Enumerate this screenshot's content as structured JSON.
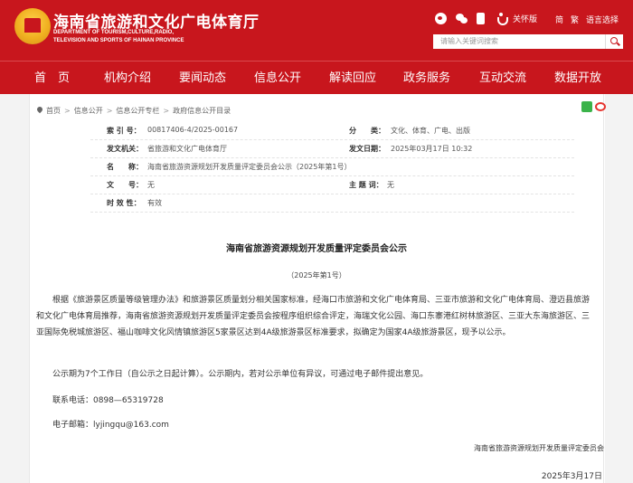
{
  "header": {
    "title": "海南省旅游和文化广电体育厅",
    "subtitle_line1": "DEPARTMENT OF TOURISM,CULTURE,RADIO,",
    "subtitle_line2": "TELEVISION AND SPORTS OF HAINAN PROVINCE",
    "care_mode": "关怀版",
    "simplified": "简",
    "traditional": "繁",
    "language": "语言选择",
    "search_placeholder": "请输入关键词搜索"
  },
  "nav": {
    "items": [
      "首　页",
      "机构介绍",
      "要闻动态",
      "信息公开",
      "解读回应",
      "政务服务",
      "互动交流",
      "数据开放"
    ]
  },
  "breadcrumb": {
    "items": [
      "首页",
      "信息公开",
      "信息公开专栏",
      "政府信息公开目录"
    ]
  },
  "meta": {
    "index_label": "索 引 号：",
    "index_value": "00817406-4/2025-00167",
    "category_label": "分　　类：",
    "category_value": "文化、体育、广电、出版",
    "issuer_label": "发文机关：",
    "issuer_value": "省旅游和文化广电体育厅",
    "date_label": "发文日期：",
    "date_value": "2025年03月17日 10:32",
    "name_label": "名　　称：",
    "name_value": "海南省旅游资源规划开发质量评定委员会公示（2025年第1号）",
    "docno_label": "文　　号：",
    "docno_value": "无",
    "topic_label": "主 题 词：",
    "topic_value": "无",
    "validity_label": "时 效 性：",
    "validity_value": "有效"
  },
  "article": {
    "title": "海南省旅游资源规划开发质量评定委员会公示",
    "subtitle": "（2025年第1号）",
    "paragraph1": "　　根据《旅游景区质量等级管理办法》和旅游景区质量划分相关国家标准，经海口市旅游和文化广电体育局、三亚市旅游和文化广电体育局、澄迈县旅游和文化广电体育局推荐，海南省旅游资源规划开发质量评定委员会按程序组织综合评定，海瑞文化公园、海口东寨港红树林旅游区、三亚大东海旅游区、三亚国际免税城旅游区、福山咖啡文化风情镇旅游区5家景区达到4A级旅游景区标准要求，拟确定为国家4A级旅游景区，现予以公示。",
    "paragraph2": "公示期为7个工作日（自公示之日起计算）。公示期内，若对公示单位有异议，可通过电子邮件提出意见。",
    "phone": "联系电话：0898—65319728",
    "email": "电子邮箱：lyjingqu@163.com",
    "signature": "海南省旅游资源规划开发质量评定委员会",
    "date": "2025年3月17日"
  },
  "colors": {
    "brand_red": "#c8161d",
    "page_bg": "#f3f3f3"
  }
}
